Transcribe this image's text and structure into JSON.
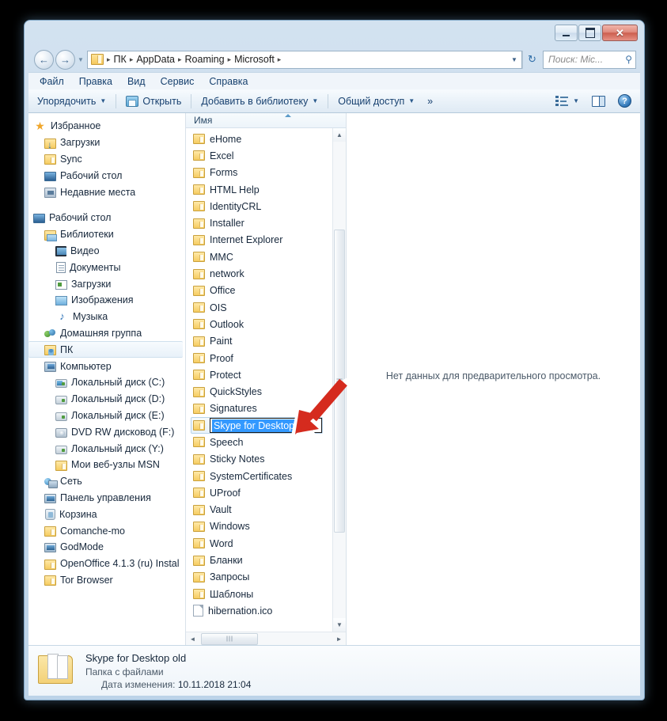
{
  "window": {
    "controls": {
      "minimize": "–",
      "maximize": "□",
      "close": "✕"
    }
  },
  "addressbar": {
    "crumbs": [
      "ПК",
      "AppData",
      "Roaming",
      "Microsoft"
    ],
    "separator": "▸",
    "dropdown_caret": "▼",
    "refresh_icon": "↻",
    "search_placeholder": "Поиск: Mic...",
    "search_icon": "⚲",
    "back_icon": "←",
    "forward_icon": "→",
    "history_caret": "▼"
  },
  "menubar": {
    "items": [
      "Файл",
      "Правка",
      "Вид",
      "Сервис",
      "Справка"
    ]
  },
  "toolbar": {
    "organize": "Упорядочить",
    "open": "Открыть",
    "add_to_library": "Добавить в библиотеку",
    "share": "Общий доступ",
    "more": "»",
    "caret": "▼",
    "help": "?"
  },
  "navpane": {
    "items": [
      {
        "label": "Избранное",
        "icon": "star-icon",
        "depth": 1,
        "selected": false
      },
      {
        "label": "Загрузки",
        "icon": "downloads-folder-icon",
        "depth": 2,
        "selected": false
      },
      {
        "label": "Sync",
        "icon": "folder-icon",
        "depth": 2,
        "selected": false
      },
      {
        "label": "Рабочий стол",
        "icon": "desktop-icon",
        "depth": 2,
        "selected": false
      },
      {
        "label": "Недавние места",
        "icon": "recent-places-icon",
        "depth": 2,
        "selected": false
      },
      {
        "label": "",
        "icon": "gap",
        "depth": 0,
        "selected": false
      },
      {
        "label": "Рабочий стол",
        "icon": "desktop-icon",
        "depth": 1,
        "selected": false
      },
      {
        "label": "Библиотеки",
        "icon": "libraries-icon",
        "depth": 2,
        "selected": false
      },
      {
        "label": "Видео",
        "icon": "video-library-icon",
        "depth": 3,
        "selected": false
      },
      {
        "label": "Документы",
        "icon": "documents-library-icon",
        "depth": 3,
        "selected": false
      },
      {
        "label": "Загрузки",
        "icon": "downloads-library-icon",
        "depth": 3,
        "selected": false
      },
      {
        "label": "Изображения",
        "icon": "pictures-library-icon",
        "depth": 3,
        "selected": false
      },
      {
        "label": "Музыка",
        "icon": "music-library-icon",
        "depth": 3,
        "selected": false
      },
      {
        "label": "Домашняя группа",
        "icon": "homegroup-icon",
        "depth": 2,
        "selected": false
      },
      {
        "label": "ПК",
        "icon": "user-folder-icon",
        "depth": 2,
        "selected": true
      },
      {
        "label": "Компьютер",
        "icon": "computer-icon",
        "depth": 2,
        "selected": false
      },
      {
        "label": "Локальный диск (C:)",
        "icon": "system-drive-icon",
        "depth": 3,
        "selected": false
      },
      {
        "label": "Локальный диск (D:)",
        "icon": "drive-icon",
        "depth": 3,
        "selected": false
      },
      {
        "label": "Локальный диск (E:)",
        "icon": "drive-icon",
        "depth": 3,
        "selected": false
      },
      {
        "label": "DVD RW дисковод (F:)",
        "icon": "dvd-drive-icon",
        "depth": 3,
        "selected": false
      },
      {
        "label": "Локальный диск (Y:)",
        "icon": "drive-icon",
        "depth": 3,
        "selected": false
      },
      {
        "label": "Мои веб-узлы MSN",
        "icon": "folder-icon",
        "depth": 3,
        "selected": false
      },
      {
        "label": "Сеть",
        "icon": "network-icon",
        "depth": 2,
        "selected": false
      },
      {
        "label": "Панель управления",
        "icon": "control-panel-icon",
        "depth": 2,
        "selected": false
      },
      {
        "label": "Корзина",
        "icon": "recycle-bin-icon",
        "depth": 2,
        "selected": false
      },
      {
        "label": "Comanche-mo",
        "icon": "folder-icon",
        "depth": 2,
        "selected": false
      },
      {
        "label": "GodMode",
        "icon": "godmode-icon",
        "depth": 2,
        "selected": false
      },
      {
        "label": "OpenOffice 4.1.3 (ru) Instal",
        "icon": "folder-icon",
        "depth": 2,
        "selected": false
      },
      {
        "label": "Tor Browser",
        "icon": "folder-icon",
        "depth": 2,
        "selected": false
      }
    ]
  },
  "filelist": {
    "column_header": "Имя",
    "items": [
      {
        "name": "eHome",
        "type": "folder"
      },
      {
        "name": "Excel",
        "type": "folder"
      },
      {
        "name": "Forms",
        "type": "folder"
      },
      {
        "name": "HTML Help",
        "type": "folder"
      },
      {
        "name": "IdentityCRL",
        "type": "folder"
      },
      {
        "name": "Installer",
        "type": "folder"
      },
      {
        "name": "Internet Explorer",
        "type": "folder"
      },
      {
        "name": "MMC",
        "type": "folder"
      },
      {
        "name": "network",
        "type": "folder"
      },
      {
        "name": "Office",
        "type": "folder"
      },
      {
        "name": "OIS",
        "type": "folder"
      },
      {
        "name": "Outlook",
        "type": "folder"
      },
      {
        "name": "Paint",
        "type": "folder"
      },
      {
        "name": "Proof",
        "type": "folder"
      },
      {
        "name": "Protect",
        "type": "folder"
      },
      {
        "name": "QuickStyles",
        "type": "folder"
      },
      {
        "name": "Signatures",
        "type": "folder"
      },
      {
        "name": "Skype for Desktop old",
        "type": "folder",
        "editing": true
      },
      {
        "name": "Speech",
        "type": "folder"
      },
      {
        "name": "Sticky Notes",
        "type": "folder"
      },
      {
        "name": "SystemCertificates",
        "type": "folder"
      },
      {
        "name": "UProof",
        "type": "folder"
      },
      {
        "name": "Vault",
        "type": "folder"
      },
      {
        "name": "Windows",
        "type": "folder"
      },
      {
        "name": "Word",
        "type": "folder"
      },
      {
        "name": "Бланки",
        "type": "folder"
      },
      {
        "name": "Запросы",
        "type": "folder"
      },
      {
        "name": "Шаблоны",
        "type": "folder"
      },
      {
        "name": "hibernation.ico",
        "type": "file"
      }
    ],
    "rename_value": "Skype for Desktop old",
    "scroll_up_icon": "▲",
    "scroll_down_icon": "▼",
    "scroll_left_icon": "◄",
    "scroll_right_icon": "►"
  },
  "preview": {
    "message": "Нет данных для предварительного просмотра."
  },
  "details": {
    "name": "Skype for Desktop old",
    "type": "Папка с файлами",
    "date_label": "Дата изменения:",
    "date_value": "10.11.2018 21:04"
  },
  "colors": {
    "selection_blue": "#3399ff",
    "annotation_red": "#d52b1e",
    "close_red": "#cc5f4f",
    "link_blue": "#17406f"
  }
}
